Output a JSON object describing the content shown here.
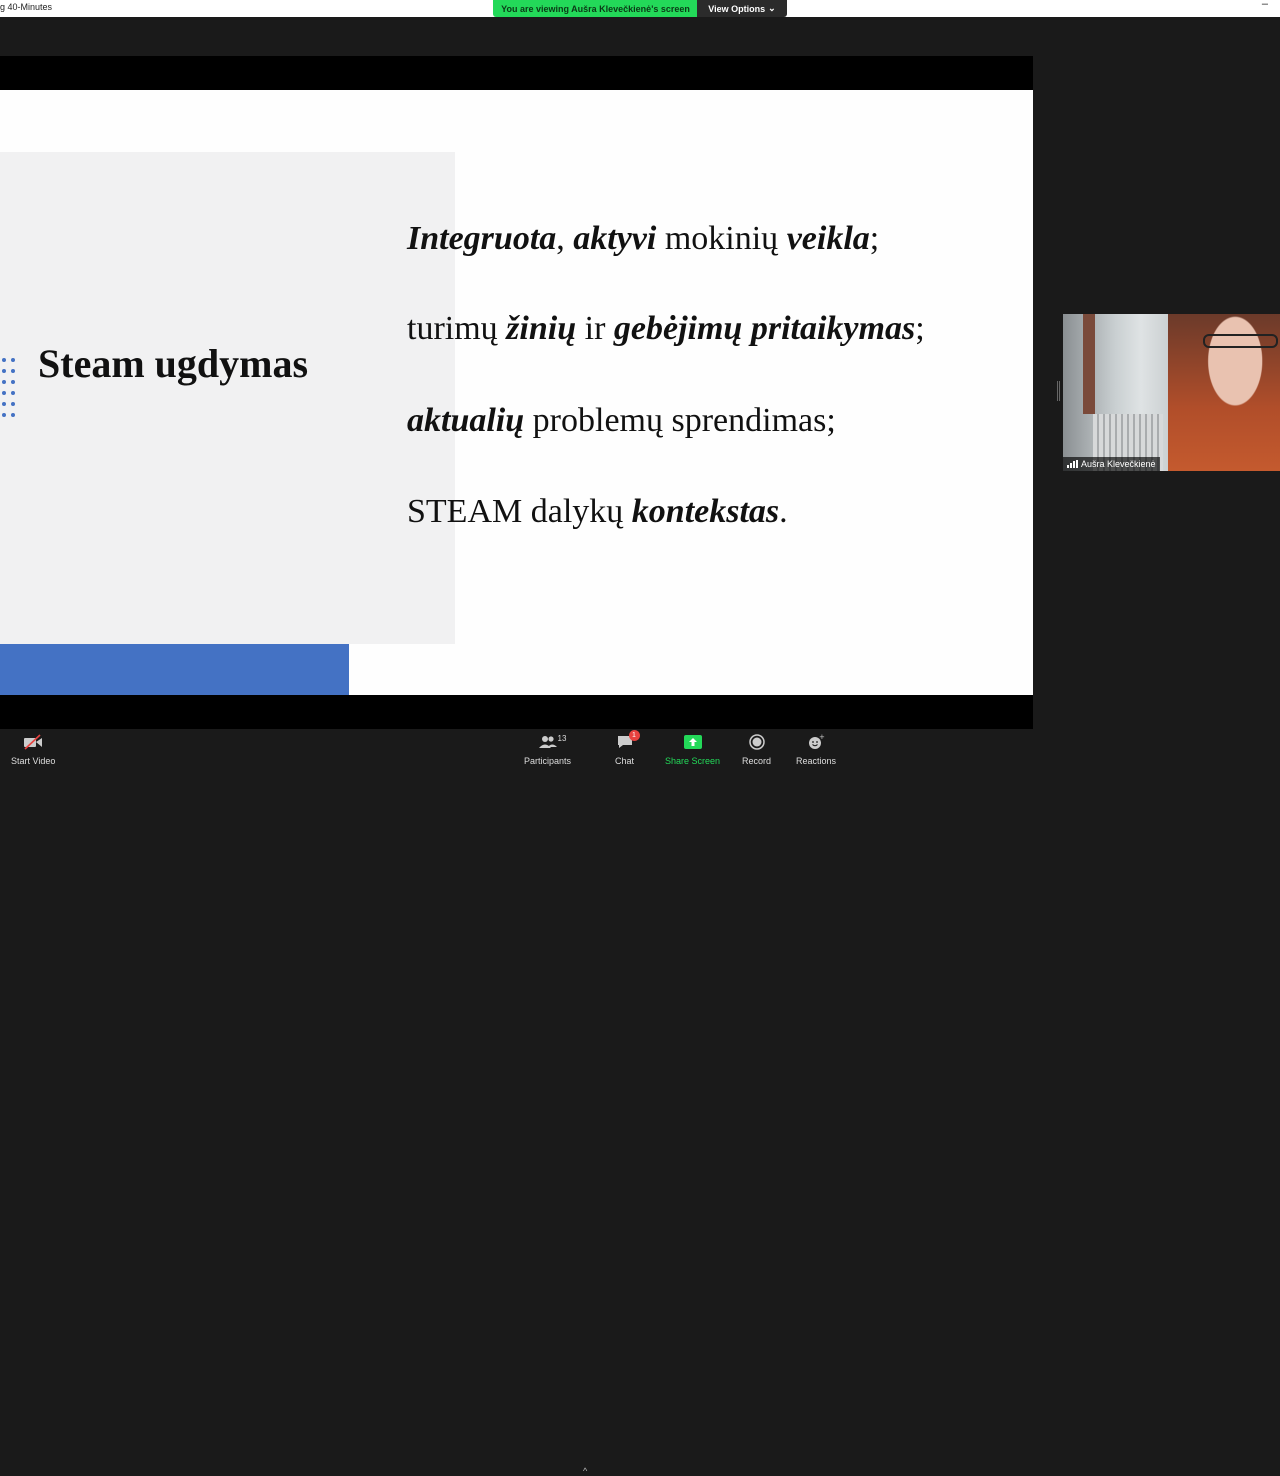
{
  "window": {
    "title": "g 40-Minutes",
    "viewing_banner": "You are viewing Aušra Klevečkienė's screen",
    "view_options_label": "View Options"
  },
  "slide": {
    "heading": "Steam ugdymas",
    "lines": [
      {
        "parts": [
          {
            "t": "Integruota",
            "b": true
          },
          {
            "t": ", ",
            "b": false
          },
          {
            "t": "aktyvi",
            "b": true
          },
          {
            "t": " mokinių ",
            "b": false
          },
          {
            "t": "veikla",
            "b": true
          },
          {
            "t": ";",
            "b": false
          }
        ]
      },
      {
        "parts": [
          {
            "t": "turimų ",
            "b": false
          },
          {
            "t": "žinių",
            "b": true
          },
          {
            "t": " ir ",
            "b": false
          },
          {
            "t": "gebėjimų pritaikymas",
            "b": true
          },
          {
            "t": ";",
            "b": false
          }
        ]
      },
      {
        "parts": [
          {
            "t": "aktualių",
            "b": true
          },
          {
            "t": " problemų sprendimas;",
            "b": false
          }
        ]
      },
      {
        "parts": [
          {
            "t": "STEAM dalykų ",
            "b": false
          },
          {
            "t": "kontekstas",
            "b": true
          },
          {
            "t": ".",
            "b": false
          }
        ]
      }
    ]
  },
  "participant_video": {
    "name": "Aušra Klevečkienė"
  },
  "toolbar": {
    "start_video": "Start Video",
    "participants": "Participants",
    "participants_count": "13",
    "chat": "Chat",
    "chat_badge": "1",
    "share_screen": "Share Screen",
    "record": "Record",
    "reactions": "Reactions"
  },
  "colors": {
    "accent_green": "#23d959",
    "slide_blue": "#4472c4",
    "badge_red": "#e8423f"
  }
}
